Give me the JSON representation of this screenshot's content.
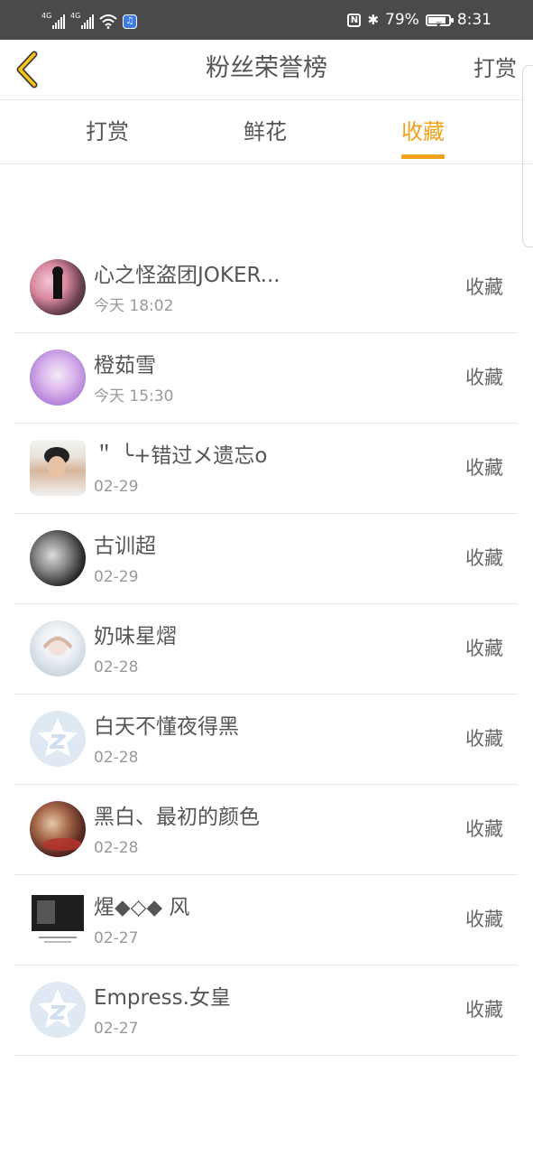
{
  "status_bar": {
    "signal_1_label": "4G",
    "signal_2_label": "4G",
    "battery_percent": "79%",
    "time": "8:31",
    "icons": [
      "signal-icon",
      "wifi-icon",
      "music-app-icon",
      "nfc-icon",
      "bluetooth-icon",
      "battery-icon"
    ]
  },
  "header": {
    "title": "粉丝荣誉榜",
    "right_action": "打赏",
    "back_icon": "chevron-left-icon",
    "accent_color": "#f0a21a"
  },
  "tabs": [
    {
      "label": "打赏",
      "active": false
    },
    {
      "label": "鲜花",
      "active": false
    },
    {
      "label": "收藏",
      "active": true
    }
  ],
  "fans": [
    {
      "name": "心之怪盗团JOKER...",
      "time": "今天 18:02",
      "action": "收藏",
      "avatar": "photo-avatar-pink"
    },
    {
      "name": "橙茹雪",
      "time": "今天 15:30",
      "action": "收藏",
      "avatar": "anime-avatar-purple"
    },
    {
      "name": "＂ ╰+错过メ遗忘o",
      "time": "02-29",
      "action": "收藏",
      "avatar": "photo-avatar-person"
    },
    {
      "name": "古训超",
      "time": "02-29",
      "action": "收藏",
      "avatar": "photo-avatar-dark"
    },
    {
      "name": "奶味星熠",
      "time": "02-28",
      "action": "收藏",
      "avatar": "anime-avatar-light"
    },
    {
      "name": "白天不懂夜得黑",
      "time": "02-28",
      "action": "收藏",
      "avatar": "default-star-avatar"
    },
    {
      "name": "黑白、最初的颜色",
      "time": "02-28",
      "action": "收藏",
      "avatar": "photo-avatar-red"
    },
    {
      "name": "煋◆◇◆ 风",
      "time": "02-27",
      "action": "收藏",
      "avatar": "photo-avatar-bw"
    },
    {
      "name": "Empress.女皇",
      "time": "02-27",
      "action": "收藏",
      "avatar": "default-star-avatar"
    }
  ]
}
